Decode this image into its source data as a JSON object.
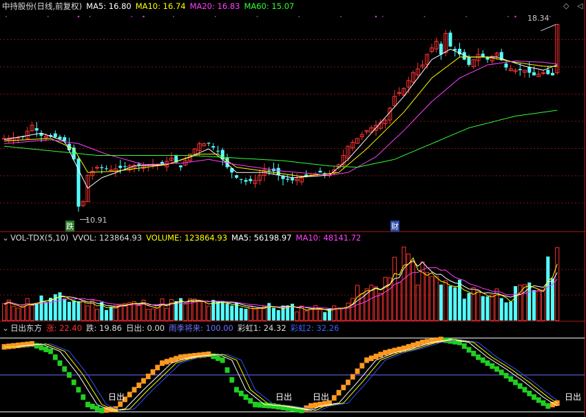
{
  "price_panel": {
    "title": "中持股份(日线,前复权)",
    "legend": [
      {
        "key": "ma5",
        "text": "MA5: 16.80",
        "color": "#ffffff"
      },
      {
        "key": "ma10",
        "text": "MA10: 16.74",
        "color": "#ffff00"
      },
      {
        "key": "ma20",
        "text": "MA20: 16.83",
        "color": "#ff40ff"
      },
      {
        "key": "ma60",
        "text": "MA60: 15.07",
        "color": "#33ff33"
      }
    ],
    "high_label": "18.34",
    "low_label": "10.91",
    "markers": [
      {
        "text": "跌",
        "color": "#2a7a2a"
      },
      {
        "text": "财",
        "color": "#2a4aa8"
      }
    ]
  },
  "volume_panel": {
    "title": "VOL-TDX(5,10)",
    "legend": [
      {
        "key": "vvol",
        "text": "VVOL: 123864.93",
        "color": "#dddddd"
      },
      {
        "key": "volume",
        "text": "VOLUME: 123864.93",
        "color": "#ffff00"
      },
      {
        "key": "ma5",
        "text": "MA5: 56198.97",
        "color": "#ffffff"
      },
      {
        "key": "ma10",
        "text": "MA10: 48141.72",
        "color": "#ff40ff"
      }
    ]
  },
  "indicator_panel": {
    "title": "日出东方",
    "legend": [
      {
        "key": "rise",
        "text": "涨: 22.40",
        "color": "#ff3030"
      },
      {
        "key": "fall",
        "text": "跌: 19.86",
        "color": "#dddddd"
      },
      {
        "key": "sunrise",
        "text": "日出: 0.00",
        "color": "#dddddd"
      },
      {
        "key": "rain",
        "text": "雨季将来: 100.00",
        "color": "#7070ff"
      },
      {
        "key": "rainbow1",
        "text": "彩虹1: 24.32",
        "color": "#dddddd"
      },
      {
        "key": "rainbow2",
        "text": "彩虹2: 32.26",
        "color": "#4060ff"
      }
    ],
    "signal_label": "日出"
  },
  "icons": [
    "circle-down-icon",
    "diamond-icon",
    "triangle-left-icon"
  ],
  "colors": {
    "up": "#ff3333",
    "down": "#54ffff",
    "ma60": "#33ff33",
    "grid": "#8a1010"
  },
  "chart_data": [
    {
      "type": "candlestick",
      "title": "中持股份(日线,前复权)",
      "ylim": [
        10.5,
        18.8
      ],
      "annotations": [
        {
          "text": "18.34",
          "bar": 119
        },
        {
          "text": "10.91",
          "bar": 16
        },
        {
          "text": "跌",
          "bar": 14
        },
        {
          "text": "财",
          "bar": 82
        }
      ],
      "series": [
        {
          "name": "MA5",
          "color": "#ffffff"
        },
        {
          "name": "MA10",
          "color": "#ffff00"
        },
        {
          "name": "MA20",
          "color": "#ff40ff"
        },
        {
          "name": "MA60",
          "color": "#33ff33"
        }
      ],
      "anchors": {
        "close": [
          [
            0,
            14.0
          ],
          [
            4,
            14.05
          ],
          [
            6,
            14.5
          ],
          [
            8,
            14.1
          ],
          [
            11,
            14.05
          ],
          [
            13,
            13.9
          ],
          [
            15,
            13.2
          ],
          [
            16,
            11.4
          ],
          [
            17,
            11.6
          ],
          [
            18,
            12.6
          ],
          [
            20,
            12.9
          ],
          [
            23,
            12.8
          ],
          [
            27,
            12.95
          ],
          [
            30,
            13.0
          ],
          [
            34,
            13.0
          ],
          [
            36,
            13.25
          ],
          [
            38,
            12.9
          ],
          [
            40,
            13.4
          ],
          [
            42,
            13.8
          ],
          [
            44,
            13.8
          ],
          [
            46,
            13.5
          ],
          [
            48,
            12.9
          ],
          [
            50,
            12.5
          ],
          [
            52,
            12.35
          ],
          [
            54,
            12.4
          ],
          [
            56,
            12.8
          ],
          [
            58,
            12.75
          ],
          [
            60,
            12.45
          ],
          [
            62,
            12.4
          ],
          [
            64,
            12.5
          ],
          [
            66,
            12.6
          ],
          [
            68,
            12.7
          ],
          [
            70,
            12.6
          ],
          [
            72,
            13.0
          ],
          [
            74,
            13.7
          ],
          [
            76,
            14.0
          ],
          [
            78,
            14.3
          ],
          [
            80,
            14.5
          ],
          [
            82,
            14.7
          ],
          [
            84,
            15.6
          ],
          [
            86,
            15.9
          ],
          [
            88,
            16.5
          ],
          [
            90,
            16.8
          ],
          [
            91,
            17.2
          ],
          [
            93,
            17.7
          ],
          [
            94,
            17.2
          ],
          [
            95,
            18.0
          ],
          [
            96,
            17.5
          ],
          [
            98,
            17.2
          ],
          [
            100,
            16.8
          ],
          [
            102,
            17.2
          ],
          [
            104,
            17.0
          ],
          [
            106,
            17.25
          ],
          [
            108,
            16.7
          ],
          [
            110,
            16.6
          ],
          [
            112,
            16.6
          ],
          [
            114,
            16.4
          ],
          [
            116,
            16.5
          ],
          [
            118,
            16.4
          ],
          [
            119,
            18.34
          ]
        ],
        "ma5": [
          [
            0,
            13.95
          ],
          [
            8,
            14.2
          ],
          [
            13,
            13.9
          ],
          [
            16,
            12.8
          ],
          [
            18,
            12.1
          ],
          [
            21,
            12.5
          ],
          [
            28,
            12.95
          ],
          [
            35,
            13.0
          ],
          [
            40,
            13.3
          ],
          [
            44,
            13.6
          ],
          [
            47,
            13.2
          ],
          [
            50,
            12.7
          ],
          [
            56,
            12.7
          ],
          [
            62,
            12.5
          ],
          [
            70,
            12.6
          ],
          [
            74,
            13.2
          ],
          [
            80,
            14.4
          ],
          [
            86,
            15.6
          ],
          [
            92,
            17.0
          ],
          [
            96,
            17.4
          ],
          [
            100,
            17.1
          ],
          [
            106,
            17.1
          ],
          [
            112,
            16.75
          ],
          [
            116,
            16.6
          ],
          [
            119,
            16.8
          ]
        ],
        "ma10": [
          [
            0,
            13.9
          ],
          [
            10,
            14.0
          ],
          [
            15,
            13.6
          ],
          [
            18,
            12.7
          ],
          [
            24,
            12.75
          ],
          [
            35,
            13.0
          ],
          [
            42,
            13.4
          ],
          [
            46,
            13.4
          ],
          [
            50,
            12.9
          ],
          [
            56,
            12.75
          ],
          [
            64,
            12.55
          ],
          [
            72,
            12.7
          ],
          [
            78,
            13.6
          ],
          [
            86,
            15.0
          ],
          [
            92,
            16.3
          ],
          [
            98,
            17.1
          ],
          [
            104,
            17.1
          ],
          [
            110,
            16.9
          ],
          [
            116,
            16.75
          ],
          [
            119,
            16.74
          ]
        ],
        "ma20": [
          [
            0,
            13.8
          ],
          [
            10,
            13.95
          ],
          [
            16,
            13.8
          ],
          [
            22,
            13.4
          ],
          [
            30,
            13.0
          ],
          [
            38,
            13.05
          ],
          [
            44,
            13.2
          ],
          [
            50,
            13.0
          ],
          [
            60,
            12.75
          ],
          [
            70,
            12.6
          ],
          [
            74,
            12.7
          ],
          [
            80,
            13.3
          ],
          [
            86,
            14.3
          ],
          [
            92,
            15.4
          ],
          [
            98,
            16.3
          ],
          [
            104,
            16.8
          ],
          [
            110,
            16.95
          ],
          [
            116,
            16.9
          ],
          [
            119,
            16.83
          ]
        ],
        "ma60": [
          [
            0,
            13.7
          ],
          [
            20,
            13.35
          ],
          [
            40,
            13.35
          ],
          [
            60,
            13.15
          ],
          [
            70,
            12.95
          ],
          [
            76,
            12.9
          ],
          [
            84,
            13.2
          ],
          [
            92,
            13.8
          ],
          [
            100,
            14.4
          ],
          [
            110,
            14.85
          ],
          [
            119,
            15.07
          ]
        ]
      }
    },
    {
      "type": "bar",
      "title": "VOL-TDX(5,10)",
      "ylim": [
        0,
        130000
      ],
      "levels": [
        [
          0,
          26000
        ],
        [
          8,
          35000
        ],
        [
          14,
          37000
        ],
        [
          16,
          34000
        ],
        [
          20,
          26000
        ],
        [
          30,
          28000
        ],
        [
          40,
          31000
        ],
        [
          46,
          27000
        ],
        [
          55,
          24000
        ],
        [
          65,
          21000
        ],
        [
          72,
          20000
        ],
        [
          74,
          42000
        ],
        [
          78,
          48000
        ],
        [
          84,
          80000
        ],
        [
          86,
          100000
        ],
        [
          90,
          80000
        ],
        [
          96,
          55000
        ],
        [
          104,
          48000
        ],
        [
          110,
          44000
        ],
        [
          116,
          60000
        ],
        [
          119,
          123864.93
        ]
      ],
      "series": [
        {
          "name": "VOLUME",
          "value": 123864.93
        },
        {
          "name": "MA5",
          "value": 56198.97,
          "color": "#ffffff"
        },
        {
          "name": "MA10",
          "value": 48141.72,
          "color": "#ff40ff"
        }
      ]
    },
    {
      "type": "line",
      "title": "日出东方",
      "ylim": [
        -5,
        105
      ],
      "hlines": [
        100,
        50,
        0
      ],
      "series": [
        {
          "name": "涨",
          "value": 22.4,
          "color": "#ff9a20"
        },
        {
          "name": "跌",
          "value": 19.86,
          "color": "#20d020"
        },
        {
          "name": "彩虹1",
          "value": 24.32,
          "color": "#ffffff"
        },
        {
          "name": "彩虹2",
          "value": 32.26,
          "color": "#3050ff"
        }
      ],
      "anchors": [
        [
          0,
          88
        ],
        [
          6,
          92
        ],
        [
          10,
          82
        ],
        [
          14,
          50
        ],
        [
          18,
          10
        ],
        [
          21,
          2
        ],
        [
          24,
          4
        ],
        [
          28,
          30
        ],
        [
          34,
          66
        ],
        [
          38,
          74
        ],
        [
          44,
          78
        ],
        [
          47,
          70
        ],
        [
          50,
          30
        ],
        [
          54,
          10
        ],
        [
          58,
          8
        ],
        [
          62,
          4
        ],
        [
          64,
          2
        ],
        [
          66,
          8
        ],
        [
          70,
          12
        ],
        [
          74,
          40
        ],
        [
          78,
          70
        ],
        [
          82,
          80
        ],
        [
          86,
          86
        ],
        [
          90,
          94
        ],
        [
          94,
          98
        ],
        [
          98,
          94
        ],
        [
          102,
          74
        ],
        [
          106,
          58
        ],
        [
          110,
          40
        ],
        [
          114,
          20
        ],
        [
          117,
          8
        ],
        [
          119,
          12
        ]
      ],
      "sunrise_bars": [
        22,
        57,
        65,
        117
      ]
    }
  ]
}
